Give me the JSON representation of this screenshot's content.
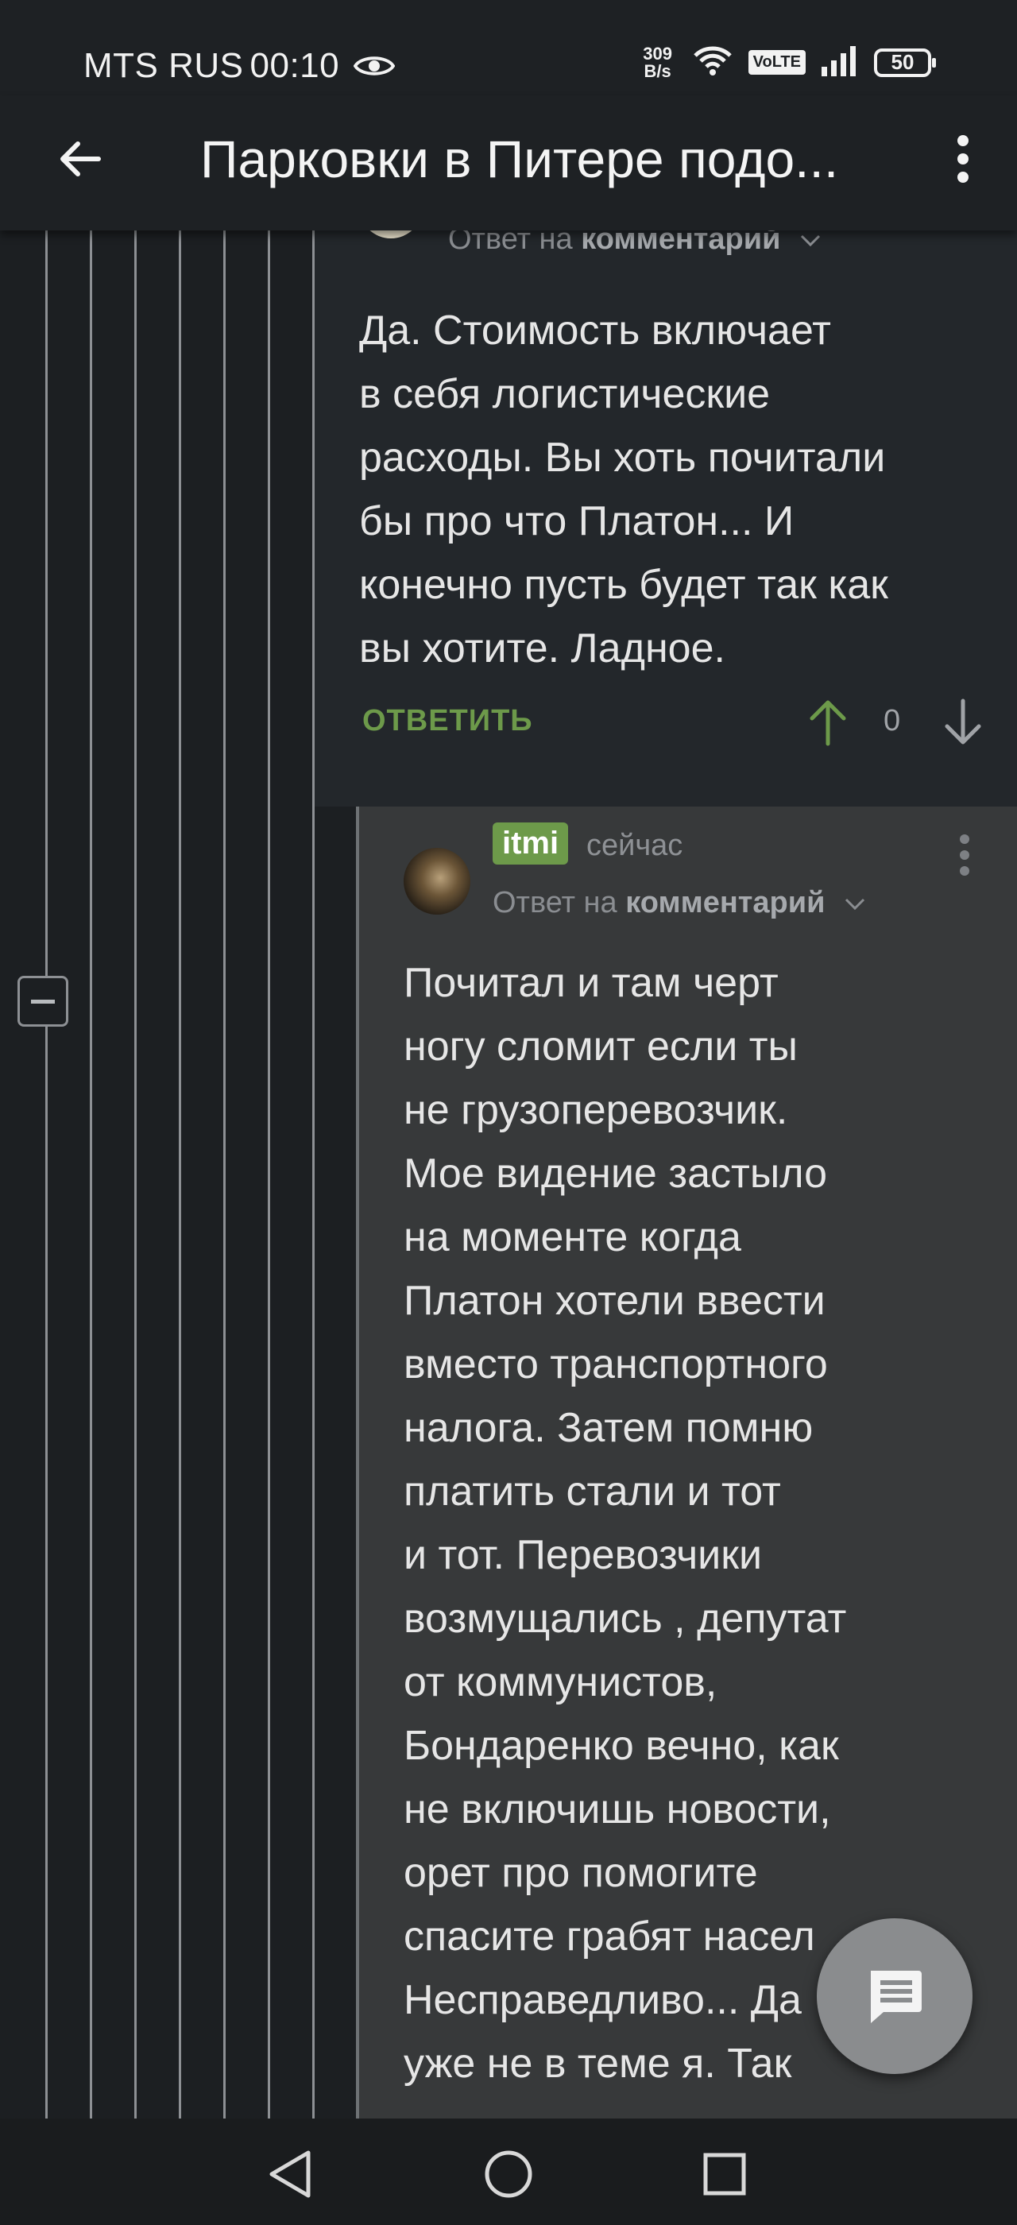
{
  "status_bar": {
    "carrier": "MTS RUS",
    "time": "00:10",
    "net_speed_value": "309",
    "net_speed_unit": "B/s",
    "volte": "VoLTE",
    "battery": "50"
  },
  "app_bar": {
    "title": "Парковки в Питере подо..."
  },
  "comment_1": {
    "reply_prefix": "Ответ на",
    "reply_target": "комментарий",
    "lines": [
      "Да. Стоимость включает",
      "в себя логистические",
      "расходы. Вы хоть почитали",
      "бы про что Платон... И",
      "конечно пусть будет так как",
      "вы хотите. Ладное."
    ],
    "reply_button": "ОТВЕТИТЬ",
    "vote_count": "0"
  },
  "comment_2": {
    "username": "itmi",
    "time": "сейчас",
    "reply_prefix": "Ответ на",
    "reply_target": "комментарий",
    "lines": [
      "Почитал и там черт",
      "ногу сломит если ты",
      "не грузоперевозчик.",
      "Мое видение застыло",
      "на моменте когда",
      "Платон хотели ввести",
      "вместо транспортного",
      "налога. Затем помню",
      "платить стали и тот",
      "и тот. Перевозчики",
      "возмущались , депутат",
      "от коммунистов,",
      "Бондаренко вечно, как",
      "не включишь новости,",
      "орет про помогите",
      "спасите грабят насел",
      "Несправедливо... Да",
      "уже не в теме я. Так"
    ]
  },
  "colors": {
    "accent_green": "#6d9a4a",
    "background": "#1c1f22",
    "nested_comment_bg": "#37393a"
  }
}
